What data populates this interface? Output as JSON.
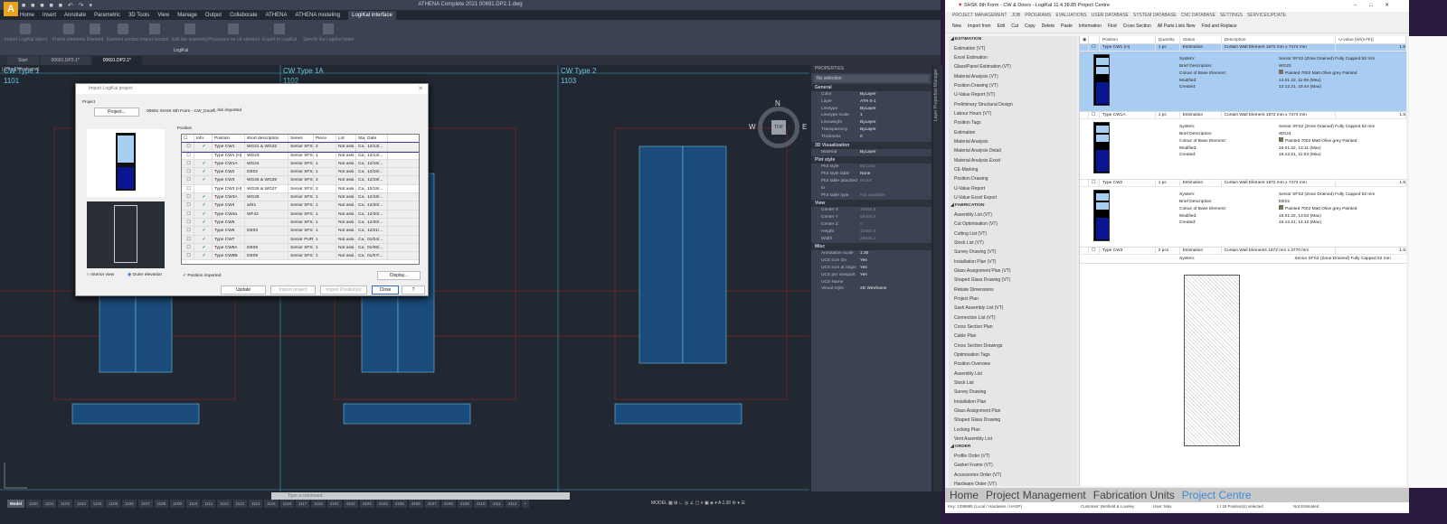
{
  "cad": {
    "title": "ATHENA Complete 2021    00691.DP2.1.dwg",
    "ribbon_tabs": [
      "Home",
      "Insert",
      "Annotate",
      "Parametric",
      "3D Tools",
      "View",
      "Manage",
      "Output",
      "Collaborate",
      "ATHENA",
      "ATHENA modeling",
      "LogiKal interface"
    ],
    "active_ribbon_tab": "LogiKal interface",
    "ribbon_buttons": [
      "Import LogiKal object",
      "Frame elements",
      "Element",
      "Element section",
      "Import section",
      "Edit bar assembly",
      "Processes on LK element",
      "Export to LogiKal",
      "Specify the LogiKal folder"
    ],
    "panel_label": "LogiKal",
    "doc_tabs": [
      "Start",
      "00691.DP3.1*",
      "00691.DP2.1*"
    ],
    "active_doc_tab": "00691.DP2.1*",
    "view_label": "[-][Top][Wireframe]",
    "drawings": [
      {
        "title": "CW Type 1",
        "number": "1101"
      },
      {
        "title": "CW Type 1A",
        "number": "1102"
      },
      {
        "title": "CW Type 2",
        "number": "1103"
      }
    ],
    "compass": {
      "n": "N",
      "w": "W",
      "e": "E",
      "top": "TOP"
    },
    "command_placeholder": "Type a command",
    "layout_tabs": [
      "Model",
      "1100",
      "1101",
      "1102",
      "1103",
      "1104",
      "1105",
      "1106",
      "1107",
      "1108",
      "1109",
      "1110",
      "1111",
      "1112",
      "1113",
      "1114",
      "1115",
      "1116",
      "1117",
      "1118",
      "4101",
      "4102",
      "4103",
      "4104",
      "4105",
      "4106",
      "4107",
      "4108",
      "4109",
      "4110",
      "4111",
      "4112",
      "+"
    ],
    "status": {
      "model": "MODEL",
      "scale": "1:30"
    },
    "layer_manager_label": "Layer Properties Manager"
  },
  "properties": {
    "header": "PROPERTIES",
    "selection": "No selection",
    "sections": [
      {
        "name": "General",
        "rows": [
          [
            "Color",
            "ByLayer"
          ],
          [
            "Layer",
            "ATH 0-1"
          ],
          [
            "Linetype",
            "ByLayer"
          ],
          [
            "Linetype scale",
            "1"
          ],
          [
            "Lineweight",
            "ByLayer"
          ],
          [
            "Transparency",
            "ByLayer"
          ],
          [
            "Thickness",
            "0"
          ]
        ]
      },
      {
        "name": "3D Visualization",
        "rows": [
          [
            "Material",
            "ByLayer"
          ]
        ]
      },
      {
        "name": "Plot style",
        "rows": [
          [
            "Plot style",
            "ByColor"
          ],
          [
            "Plot style table",
            "None"
          ],
          [
            "Plot table attached to",
            "Model"
          ],
          [
            "Plot table type",
            "Not available"
          ]
        ]
      },
      {
        "name": "View",
        "rows": [
          [
            "Center X",
            "16846.5"
          ],
          [
            "Center Y",
            "59404.8"
          ],
          [
            "Center Z",
            "0"
          ],
          [
            "Height",
            "15557.4"
          ],
          [
            "Width",
            "28845.1"
          ]
        ]
      },
      {
        "name": "Misc",
        "rows": [
          [
            "Annotation scale",
            "1:30"
          ],
          [
            "UCS icon On",
            "Yes"
          ],
          [
            "UCS icon at origin",
            "Yes"
          ],
          [
            "UCS per viewport",
            "Yes"
          ],
          [
            "UCS Name",
            ""
          ],
          [
            "Visual Style",
            "2D Wireframe"
          ]
        ]
      }
    ]
  },
  "dialog": {
    "title": "Import LogiKal project",
    "project_group": "Project",
    "project_button": "Project...",
    "project_name": "00691 SHSK 6th Form - CW_Doors",
    "job_status": "Job imported",
    "position_group": "Position",
    "columns": [
      "",
      "Info",
      "Position",
      "short description",
      "Series",
      "Piece",
      "Lot",
      "Stat.",
      "Date"
    ],
    "rows": [
      [
        true,
        "Type CW1",
        "WG21 & WG22",
        "Senior SFS2...",
        "2",
        "Not assi...",
        "Ca...",
        "12/13/..."
      ],
      [
        false,
        "Type CW1 (H)",
        "WG23",
        "Senior SFS2...",
        "1",
        "Not assi...",
        "Ca...",
        "12/13/..."
      ],
      [
        true,
        "Type CW1A",
        "WG24",
        "Senior SFS2...",
        "1",
        "Not assi...",
        "Ca...",
        "12/16/..."
      ],
      [
        true,
        "Type CW2",
        "DE02",
        "Senior SFS2...",
        "1",
        "Not assi...",
        "Ca...",
        "12/16/..."
      ],
      [
        true,
        "Type CW3",
        "WG25 & WG29",
        "Senior SFS2...",
        "2",
        "Not assi...",
        "Ca...",
        "12/18/..."
      ],
      [
        false,
        "Type CW3 (H)",
        "WG26 & WG27",
        "Senior SFS2...",
        "2",
        "Not assi...",
        "Ca...",
        "12/18/..."
      ],
      [
        true,
        "Type CW3A",
        "WG28",
        "Senior SFS2...",
        "1",
        "Not assi...",
        "Ca...",
        "12/18/..."
      ],
      [
        true,
        "Type CW4",
        "wf41",
        "Senior SFS2...",
        "1",
        "Not assi...",
        "Ca...",
        "12/20/..."
      ],
      [
        true,
        "Type CW4a",
        "WF42",
        "Senior SFS2...",
        "1",
        "Not assi...",
        "Ca...",
        "12/20/..."
      ],
      [
        true,
        "Type CW5",
        "",
        "Senior SFS2...",
        "1",
        "Not assi...",
        "Ca...",
        "12/20/..."
      ],
      [
        true,
        "Type CW6",
        "DE03",
        "Senior SFS2...",
        "1",
        "Not assi...",
        "Ca...",
        "12/21/..."
      ],
      [
        true,
        "Type CW7",
        "",
        "Senior PUR...",
        "1",
        "Not assi...",
        "Ca...",
        "01/04/..."
      ],
      [
        true,
        "Type CW8A",
        "DE08",
        "Senior SFS2...",
        "1",
        "Not assi...",
        "Ca...",
        "01/06/..."
      ],
      [
        true,
        "Type CW8B",
        "DE09",
        "Senior SFS2...",
        "1",
        "Not assi...",
        "Ca...",
        "01/07/..."
      ]
    ],
    "view_options": [
      "Interior view",
      "Outer elevation"
    ],
    "selected_view": "Outer elevation",
    "position_status": "Position imported",
    "buttons": {
      "display": "Display...",
      "update": "Update",
      "import_project": "Import project",
      "import_positions": "Import Position(s)",
      "close": "Close",
      "help": "?"
    }
  },
  "logikal": {
    "title": "SHSK 6th Form - CW & Doors - LogiKal 11.4.38.85 Project Centre",
    "menu": [
      "PROJECT MANAGEMENT",
      "JOB",
      "PROGRAMS",
      "EVALUATIONS",
      "USER DATABASE",
      "SYSTEM DATABASE",
      "CNC DATABASE",
      "SETTINGS",
      "SERVICE/UPDATE"
    ],
    "toolbar": [
      "New",
      "Import from",
      "Edit",
      "Cut",
      "Copy",
      "Delete",
      "Paste",
      "Information",
      "Find",
      "Cross Section",
      "All Parts Lists New",
      "Find and Replace"
    ],
    "tree": [
      {
        "section": "ESTIMATION",
        "items": [
          "Estimation (VT)",
          "Excel Estimation",
          "Glass/Panel Estimation (VT)",
          "Material Analysis (VT)",
          "Position Drawing (VT)",
          "U-Value Report (VT)",
          "Preliminary Structural Design",
          "Labour Hours (VT)",
          "Position Tags",
          "Estimation",
          "Material Analysis",
          "Material Analysis Detail",
          "Material Analysis Excel",
          "CE-Marking",
          "Position Drawing",
          "U-Value Report",
          "U-Value Excel Export"
        ]
      },
      {
        "section": "FABRICATION",
        "items": [
          "Assembly List (VT)",
          "Cut Optimisation (VT)",
          "Cutting List (VT)",
          "Stock List (VT)",
          "Survey Drawing (VT)",
          "Installation Plan (VT)",
          "Glass Assignment Plan (VT)",
          "Shaped Glass Drawing (VT)",
          "Rebate Dimensions",
          "Project Plan",
          "Sash Assembly List (VT)",
          "Connection List (VT)",
          "Cross Section Plan",
          "Cable Plan",
          "Cross Section Drawings",
          "Optimisation Tags",
          "Position Overview",
          "Assembly List",
          "Stock List",
          "Survey Drawing",
          "Installation Plan",
          "Glass Assignment Plan",
          "Shaped Glass Drawing",
          "Locking Plan",
          "Vent Assembly List"
        ]
      },
      {
        "section": "ORDER",
        "items": [
          "Profile Order (VT)",
          "Gasket Frame (VT)",
          "Accessories Order (VT)",
          "Hardware Order (VT)"
        ]
      }
    ],
    "columns": [
      "Position",
      "Quantity",
      "Status",
      "Description",
      "U-value [W/(m²K)]"
    ],
    "detail_labels": [
      "System:",
      "Brief Description:",
      "Colour of Base Element:",
      "Modified:",
      "Created:"
    ],
    "positions": [
      {
        "position": "Type CW1 (H)",
        "quantity": "1 pc",
        "status": "Estimation",
        "description": "Curtain Wall Element 1872 mm x 7474 mm",
        "uvalue": "1.5",
        "system": "Senior SFS2 (Zone Drained) Fully Capped 52 mm",
        "brief": "WG23",
        "colour": "Painted 7002 Matt Olive grey Painted",
        "modified": "14.01.22, 11:06 (Max)",
        "created": "13.12.21, 15:44 (Max)",
        "selected": true
      },
      {
        "position": "Type CW1A",
        "quantity": "1 pc",
        "status": "Estimation",
        "description": "Curtain Wall Element 1872 mm x 7474 mm",
        "uvalue": "1.5",
        "system": "Senior SFS2 (Zone Drained) Fully Capped 52 mm",
        "brief": "WG24",
        "colour": "Painted 7002 Matt Olive grey Painted",
        "modified": "15.01.22, 13:11 (Max)",
        "created": "16.12.21, 11:03 (Max)",
        "selected": false
      },
      {
        "position": "Type CW2",
        "quantity": "1 pc",
        "status": "Estimation",
        "description": "Curtain Wall Element 1872 mm x 7474 mm",
        "uvalue": "1.5",
        "system": "Senior SFS2 (Zone Drained) Fully Capped 52 mm",
        "brief": "DE02",
        "colour": "Painted 7002 Matt Olive grey Painted",
        "modified": "15.01.22, 13:54 (Max)",
        "created": "16.12.21, 14:12 (Max)",
        "selected": false
      }
    ],
    "partial_position": {
      "position": "Type CW3",
      "quantity": "2 pcs",
      "status": "Estimation",
      "description": "Curtain Wall Elements 1872 mm x 3770 mm",
      "uvalue": "1.6",
      "system": "Senior SFS2 (Zone Drained) Fully Capped 52 mm"
    },
    "colour_swatch": "#7a7260",
    "nav": [
      "Home",
      "Project Management",
      "Fabrication Units",
      "Project Centre"
    ],
    "active_nav": "Project Centre",
    "status": {
      "key": "Key: 1298895 (Local / Hardware / HASP)",
      "customer": "Customer: Benfield & Loxeley",
      "user": "User: Max",
      "selection": "1 / 19 Position(s) selected",
      "estimate": "Not Estimated"
    }
  }
}
